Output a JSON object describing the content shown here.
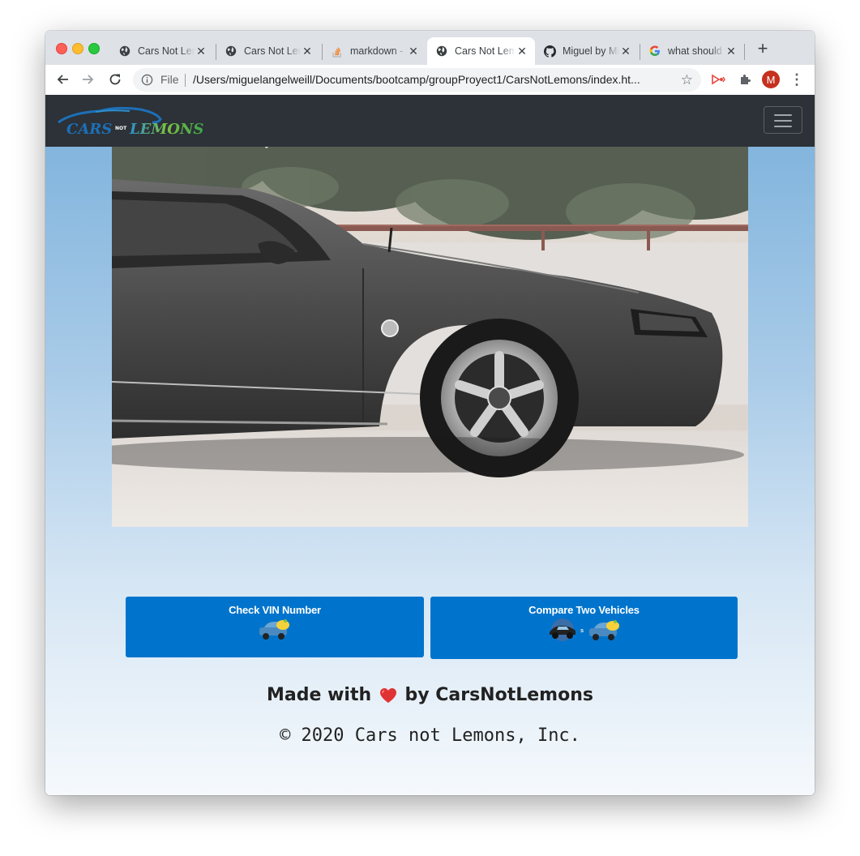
{
  "browser": {
    "tabs": [
      {
        "title": "Cars Not Lemons",
        "icon": "globe-icon",
        "active": false
      },
      {
        "title": "Cars Not Lemons",
        "icon": "globe-icon",
        "active": false
      },
      {
        "title": "markdown - Stack Overflow",
        "icon": "stackoverflow-icon",
        "active": false
      },
      {
        "title": "Cars Not Lemons",
        "icon": "globe-icon",
        "active": true
      },
      {
        "title": "Miguel by Miguel",
        "icon": "github-icon",
        "active": false
      },
      {
        "title": "what should",
        "icon": "google-icon",
        "active": false
      }
    ],
    "new_tab_label": "+",
    "address": {
      "scheme_label": "File",
      "url": "/Users/miguelangelweill/Documents/bootcamp/groupProyect1/CarsNotLemons/index.ht..."
    },
    "profile_initial": "M",
    "colors": {
      "profile": "#c5311e",
      "tabstrip": "#dee1e6"
    }
  },
  "page": {
    "brand": {
      "text_cars": "CARS",
      "text_not": "NOT",
      "text_lemons": "LEMONS"
    },
    "buttons": {
      "check_vin": "Check VIN Number",
      "compare": "Compare Two Vehicles"
    },
    "footer": {
      "made_with": "Made with",
      "by": "by CarsNotLemons",
      "copyright": "© 2020 Cars not Lemons, Inc."
    },
    "colors": {
      "navbar": "#2c3237",
      "button": "#0074cc"
    }
  }
}
